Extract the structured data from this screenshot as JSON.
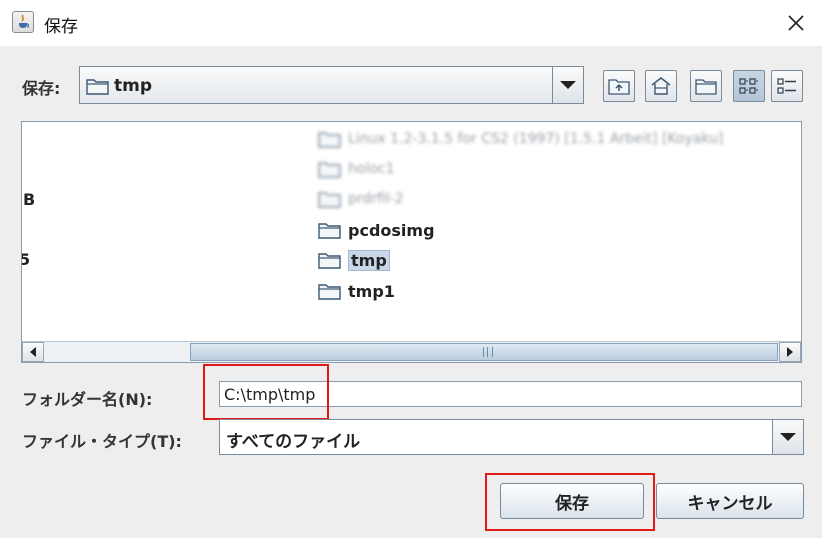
{
  "window": {
    "title": "保存",
    "close_glyph": "✕"
  },
  "save_in": {
    "label": "保存:",
    "selected": "tmp"
  },
  "toolbar_icons": [
    "up-folder-icon",
    "home-icon",
    "new-folder-icon",
    "list-view-icon",
    "details-view-icon"
  ],
  "file_list": {
    "cut_off_left": [
      "B",
      "5"
    ],
    "items": [
      {
        "name": "Linux 1.2-3.1.5 for CS2 (1997) [1.5.1 Arbeit] [Koyaku]",
        "blurred": true
      },
      {
        "name": "holoc1",
        "blurred": true
      },
      {
        "name": "prdrfil-2",
        "blurred": true
      },
      {
        "name": "pcdosimg",
        "blurred": false
      },
      {
        "name": "tmp",
        "blurred": false,
        "selected": true
      },
      {
        "name": "tmp1",
        "blurred": false
      }
    ]
  },
  "folder_name": {
    "label": "フォルダー名(N):",
    "value": "C:\\tmp\\tmp"
  },
  "file_type": {
    "label": "ファイル・タイプ(T):",
    "selected": "すべてのファイル"
  },
  "buttons": {
    "save": "保存",
    "cancel": "キャンセル"
  },
  "colors": {
    "highlight_box": "#e01818",
    "selection": "#c7d7e8"
  }
}
